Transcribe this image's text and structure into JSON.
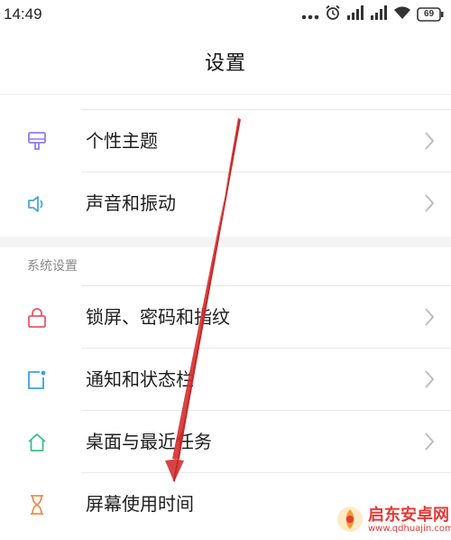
{
  "status_bar": {
    "time": "14:49",
    "battery": "69",
    "icons": [
      "more-dots-icon",
      "alarm-icon",
      "signal-icon",
      "signal-icon",
      "wifi-icon",
      "battery-icon"
    ]
  },
  "header": {
    "title": "设置"
  },
  "rows_top": [
    {
      "label": "个性主题",
      "icon": "theme-brush-icon",
      "icon_color": "#8e7cf0"
    },
    {
      "label": "声音和振动",
      "icon": "speaker-icon",
      "icon_color": "#4aa8d8"
    }
  ],
  "section": {
    "header": "系统设置"
  },
  "rows_system": [
    {
      "label": "锁屏、密码和指纹",
      "icon": "lock-icon",
      "icon_color": "#e8596a"
    },
    {
      "label": "通知和状态栏",
      "icon": "notification-icon",
      "icon_color": "#3ea0e4"
    },
    {
      "label": "桌面与最近任务",
      "icon": "home-icon",
      "icon_color": "#3dbf8a"
    },
    {
      "label": "屏幕使用时间",
      "icon": "hourglass-icon",
      "icon_color": "#f08c4a"
    }
  ],
  "watermark": {
    "name": "启东安卓网",
    "url": "www.qdhuajin.com"
  },
  "colors": {
    "chevron": "#bdbdbd",
    "arrow": "#d32f2f"
  }
}
